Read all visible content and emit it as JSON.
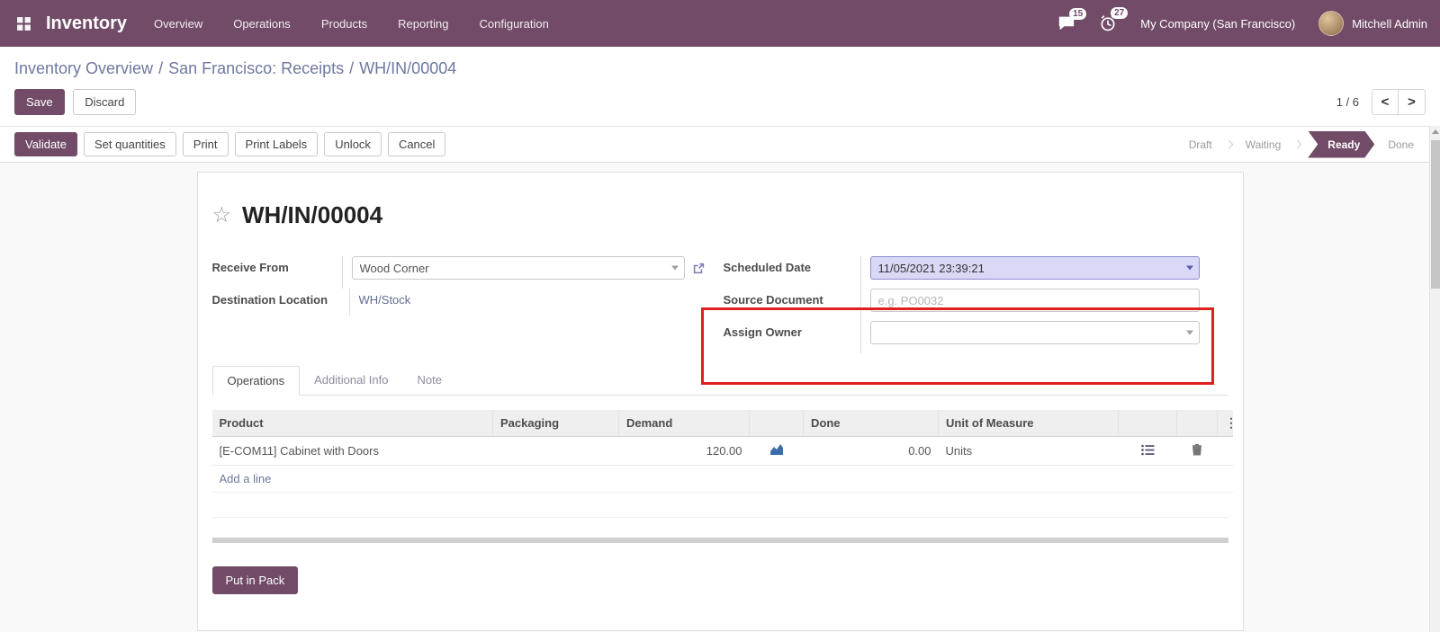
{
  "colors": {
    "navbar_bg": "#714B67",
    "primary": "#714B67",
    "annotation": "#e0201f",
    "scheduled_highlight_bg": "#d9d9f7"
  },
  "icons": {
    "apps": "grid",
    "messages": "speech-bubble",
    "activities": "clock",
    "favorite": "star-outline",
    "external_link": "arrow-out-of-box",
    "dropdown": "caret-down",
    "forecast": "area-chart",
    "row_details": "list",
    "row_delete": "trash",
    "more_columns": "kebab-vertical",
    "pager_prev": "chevron-left",
    "pager_next": "chevron-right"
  },
  "navbar": {
    "brand": "Inventory",
    "menus": [
      "Overview",
      "Operations",
      "Products",
      "Reporting",
      "Configuration"
    ],
    "messages_count": "15",
    "activities_count": "27",
    "company": "My Company (San Francisco)",
    "user": "Mitchell Admin"
  },
  "breadcrumb": {
    "separator": "/",
    "items": [
      "Inventory Overview",
      "San Francisco: Receipts",
      "WH/IN/00004"
    ]
  },
  "control_panel": {
    "save": "Save",
    "discard": "Discard",
    "pager": "1 / 6",
    "prev": "<",
    "next": ">"
  },
  "statusbar": {
    "buttons": [
      "Validate",
      "Set quantities",
      "Print",
      "Print Labels",
      "Unlock",
      "Cancel"
    ],
    "states": [
      "Draft",
      "Waiting",
      "Ready",
      "Done"
    ],
    "active_state": "Ready"
  },
  "form": {
    "title": "WH/IN/00004",
    "fields": {
      "receive_from": {
        "label": "Receive From",
        "value": "Wood Corner"
      },
      "destination_location": {
        "label": "Destination Location",
        "value": "WH/Stock"
      },
      "scheduled_date": {
        "label": "Scheduled Date",
        "value": "11/05/2021 23:39:21"
      },
      "source_document": {
        "label": "Source Document",
        "placeholder": "e.g. PO0032"
      },
      "assign_owner": {
        "label": "Assign Owner",
        "value": ""
      }
    },
    "tabs": [
      "Operations",
      "Additional Info",
      "Note"
    ],
    "active_tab": "Operations",
    "operations_table": {
      "headers": [
        "Product",
        "Packaging",
        "Demand",
        "Done",
        "Unit of Measure"
      ],
      "rows": [
        {
          "product": "[E-COM11] Cabinet with Doors",
          "packaging": "",
          "demand": "120.00",
          "done": "0.00",
          "uom": "Units"
        }
      ],
      "add_line": "Add a line",
      "more_icon": "⋮"
    },
    "buttons": {
      "put_in_pack": "Put in Pack"
    }
  }
}
